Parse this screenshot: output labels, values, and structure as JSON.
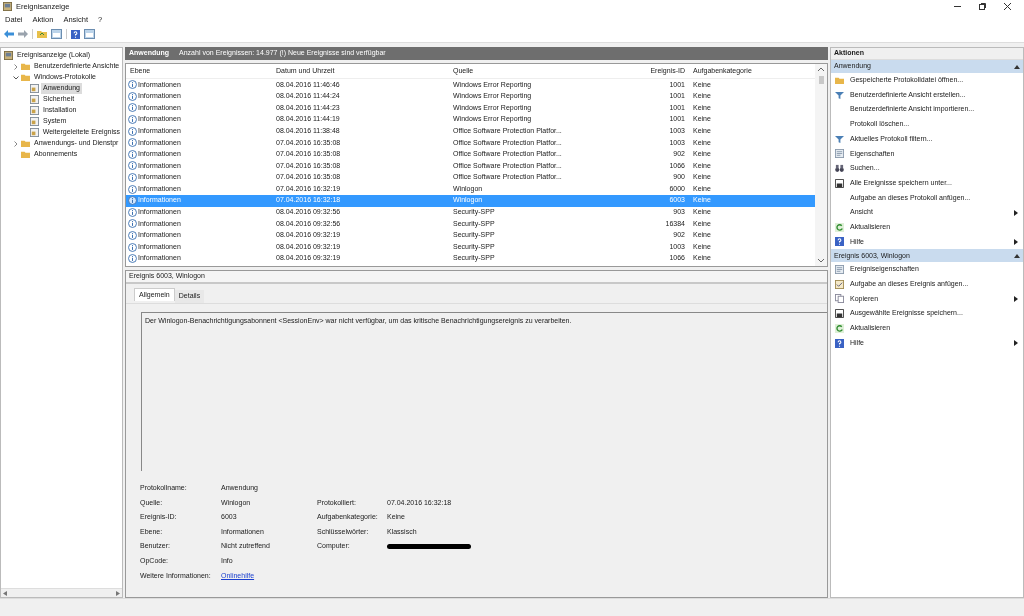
{
  "window": {
    "title": "Ereignisanzeige"
  },
  "menu": [
    "Datei",
    "Aktion",
    "Ansicht",
    "?"
  ],
  "tree": [
    {
      "label": "Ereignisanzeige (Lokal)",
      "kind": "computer",
      "selected": false,
      "children": [
        {
          "label": "Benutzerdefinierte Ansichte",
          "kind": "folder",
          "selected": false,
          "expanded": false
        },
        {
          "label": "Windows-Protokolle",
          "kind": "folder",
          "selected": false,
          "expanded": true,
          "children": [
            {
              "label": "Anwendung",
              "kind": "log",
              "selected": true
            },
            {
              "label": "Sicherheit",
              "kind": "log",
              "selected": false
            },
            {
              "label": "Installation",
              "kind": "log",
              "selected": false
            },
            {
              "label": "System",
              "kind": "log",
              "selected": false
            },
            {
              "label": "Weitergeleitete Ereigniss",
              "kind": "log",
              "selected": false
            }
          ]
        },
        {
          "label": "Anwendungs- und Dienstpr",
          "kind": "folder",
          "selected": false,
          "expanded": false
        },
        {
          "label": "Abonnements",
          "kind": "folder",
          "selected": false
        }
      ]
    }
  ],
  "log_header": {
    "name": "Anwendung",
    "info": "Anzahl von Ereignissen: 14.977 (!) Neue Ereignisse sind verfügbar"
  },
  "table": {
    "columns": [
      "Ebene",
      "Datum und Uhrzeit",
      "Quelle",
      "Ereignis-ID",
      "Aufgabenkategorie"
    ],
    "rows": [
      {
        "level": "Informationen",
        "date": "08.04.2016 11:46:46",
        "source": "Windows Error Reporting",
        "id": "1001",
        "category": "Keine",
        "selected": false
      },
      {
        "level": "Informationen",
        "date": "08.04.2016 11:44:24",
        "source": "Windows Error Reporting",
        "id": "1001",
        "category": "Keine",
        "selected": false
      },
      {
        "level": "Informationen",
        "date": "08.04.2016 11:44:23",
        "source": "Windows Error Reporting",
        "id": "1001",
        "category": "Keine",
        "selected": false
      },
      {
        "level": "Informationen",
        "date": "08.04.2016 11:44:19",
        "source": "Windows Error Reporting",
        "id": "1001",
        "category": "Keine",
        "selected": false
      },
      {
        "level": "Informationen",
        "date": "08.04.2016 11:38:48",
        "source": "Office Software Protection Platfor...",
        "id": "1003",
        "category": "Keine",
        "selected": false
      },
      {
        "level": "Informationen",
        "date": "07.04.2016 16:35:08",
        "source": "Office Software Protection Platfor...",
        "id": "1003",
        "category": "Keine",
        "selected": false
      },
      {
        "level": "Informationen",
        "date": "07.04.2016 16:35:08",
        "source": "Office Software Protection Platfor...",
        "id": "902",
        "category": "Keine",
        "selected": false
      },
      {
        "level": "Informationen",
        "date": "07.04.2016 16:35:08",
        "source": "Office Software Protection Platfor...",
        "id": "1066",
        "category": "Keine",
        "selected": false
      },
      {
        "level": "Informationen",
        "date": "07.04.2016 16:35:08",
        "source": "Office Software Protection Platfor...",
        "id": "900",
        "category": "Keine",
        "selected": false
      },
      {
        "level": "Informationen",
        "date": "07.04.2016 16:32:19",
        "source": "Winlogon",
        "id": "6000",
        "category": "Keine",
        "selected": false
      },
      {
        "level": "Informationen",
        "date": "07.04.2016 16:32:18",
        "source": "Winlogon",
        "id": "6003",
        "category": "Keine",
        "selected": true
      },
      {
        "level": "Informationen",
        "date": "08.04.2016 09:32:56",
        "source": "Security-SPP",
        "id": "903",
        "category": "Keine",
        "selected": false
      },
      {
        "level": "Informationen",
        "date": "08.04.2016 09:32:56",
        "source": "Security-SPP",
        "id": "16384",
        "category": "Keine",
        "selected": false
      },
      {
        "level": "Informationen",
        "date": "08.04.2016 09:32:19",
        "source": "Security-SPP",
        "id": "902",
        "category": "Keine",
        "selected": false
      },
      {
        "level": "Informationen",
        "date": "08.04.2016 09:32:19",
        "source": "Security-SPP",
        "id": "1003",
        "category": "Keine",
        "selected": false
      },
      {
        "level": "Informationen",
        "date": "08.04.2016 09:32:19",
        "source": "Security-SPP",
        "id": "1066",
        "category": "Keine",
        "selected": false
      }
    ]
  },
  "detail": {
    "title": "Ereignis 6003, Winlogon",
    "tabs": [
      {
        "label": "Allgemein",
        "selected": true
      },
      {
        "label": "Details",
        "selected": false
      }
    ],
    "message": "Der Winlogon-Benachrichtigungsabonnent <SessionEnv> war nicht verfügbar, um das kritische Benachrichtigungsereignis zu verarbeiten.",
    "fields_left": [
      {
        "label": "Protokollname:",
        "value": "Anwendung"
      },
      {
        "label": "Quelle:",
        "value": "Winlogon"
      },
      {
        "label": "Ereignis-ID:",
        "value": "6003"
      },
      {
        "label": "Ebene:",
        "value": "Informationen"
      },
      {
        "label": "Benutzer:",
        "value": "Nicht zutreffend"
      },
      {
        "label": "OpCode:",
        "value": "Info"
      },
      {
        "label": "Weitere Informationen:",
        "value": "Onlinehilfe",
        "kind": "link"
      }
    ],
    "fields_right": [
      {
        "label": "Protokolliert:",
        "value": "07.04.2016 16:32:18"
      },
      {
        "label": "Aufgabenkategorie:",
        "value": "Keine"
      },
      {
        "label": "Schlüsselwörter:",
        "value": "Klassisch"
      },
      {
        "label": "Computer:",
        "kind": "redacted"
      }
    ]
  },
  "actions": {
    "title": "Aktionen",
    "sections": [
      {
        "title": "Anwendung",
        "items": [
          {
            "label": "Gespeicherte Protokolldatei öffnen...",
            "kind": "folder",
            "submenu": false
          },
          {
            "label": "Benutzerdefinierte Ansicht erstellen...",
            "kind": "filter",
            "submenu": false
          },
          {
            "label": "Benutzerdefinierte Ansicht importieren...",
            "kind": "none",
            "submenu": false
          },
          {
            "label": "Protokoll löschen...",
            "kind": "none",
            "submenu": false
          },
          {
            "label": "Aktuelles Protokoll filtern...",
            "kind": "filter",
            "submenu": false
          },
          {
            "label": "Eigenschaften",
            "kind": "properties",
            "submenu": false
          },
          {
            "label": "Suchen...",
            "kind": "binoculars",
            "submenu": false
          },
          {
            "label": "Alle Ereignisse speichern unter...",
            "kind": "save",
            "submenu": false
          },
          {
            "label": "Aufgabe an dieses Protokoll anfügen...",
            "kind": "none",
            "submenu": false
          },
          {
            "label": "Ansicht",
            "kind": "none",
            "submenu": true
          },
          {
            "label": "Aktualisieren",
            "kind": "refresh",
            "submenu": false
          },
          {
            "label": "Hilfe",
            "kind": "help",
            "submenu": true
          }
        ]
      },
      {
        "title": "Ereignis 6003, Winlogon",
        "items": [
          {
            "label": "Ereigniseigenschaften",
            "kind": "properties",
            "submenu": false
          },
          {
            "label": "Aufgabe an dieses Ereignis anfügen...",
            "kind": "task",
            "submenu": false
          },
          {
            "label": "Kopieren",
            "kind": "copy",
            "submenu": true
          },
          {
            "label": "Ausgewählte Ereignisse speichern...",
            "kind": "save",
            "submenu": false
          },
          {
            "label": "Aktualisieren",
            "kind": "refresh",
            "submenu": false
          },
          {
            "label": "Hilfe",
            "kind": "help",
            "submenu": true
          }
        ]
      }
    ]
  }
}
